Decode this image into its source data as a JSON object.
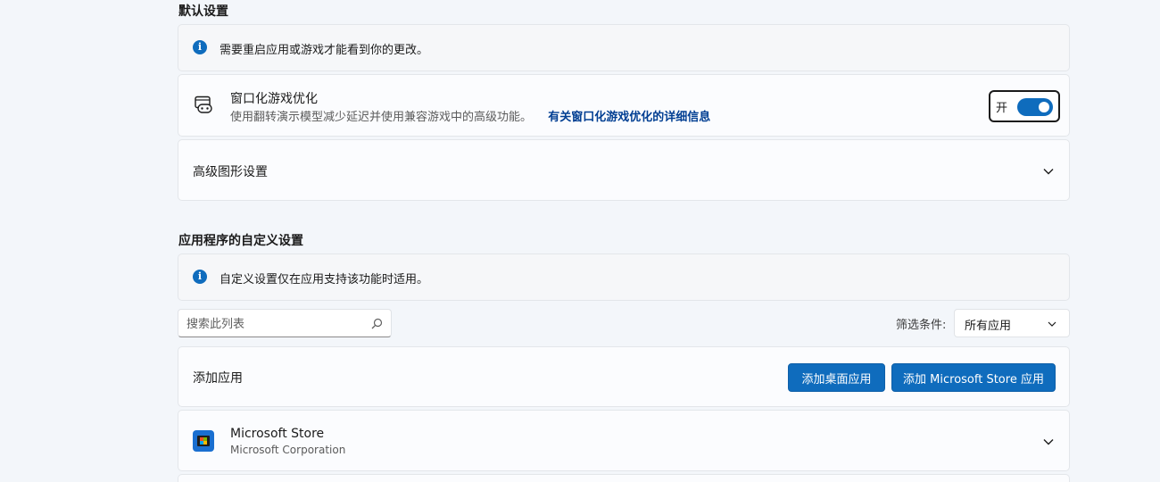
{
  "default_settings": {
    "title": "默认设置",
    "info_text": "需要重启应用或游戏才能看到你的更改。",
    "windowed_game": {
      "title": "窗口化游戏优化",
      "description": "使用翻转演示模型减少延迟并使用兼容游戏中的高级功能。",
      "link": "有关窗口化游戏优化的详细信息",
      "toggle_label": "开",
      "toggle_on": true
    },
    "advanced_graphics": {
      "title": "高级图形设置"
    }
  },
  "custom_settings": {
    "title": "应用程序的自定义设置",
    "info_text": "自定义设置仅在应用支持该功能时适用。",
    "search": {
      "placeholder": "搜索此列表"
    },
    "filter": {
      "label": "筛选条件:",
      "selected": "所有应用"
    },
    "add_app": {
      "title": "添加应用",
      "desktop_button": "添加桌面应用",
      "store_button": "添加 Microsoft Store 应用"
    },
    "apps": [
      {
        "name": "Microsoft Store",
        "publisher": "Microsoft Corporation"
      }
    ]
  },
  "colors": {
    "accent": "#0f6cbd",
    "link": "#003e92",
    "background": "#f3f6fa",
    "card": "#fbfcfe"
  }
}
